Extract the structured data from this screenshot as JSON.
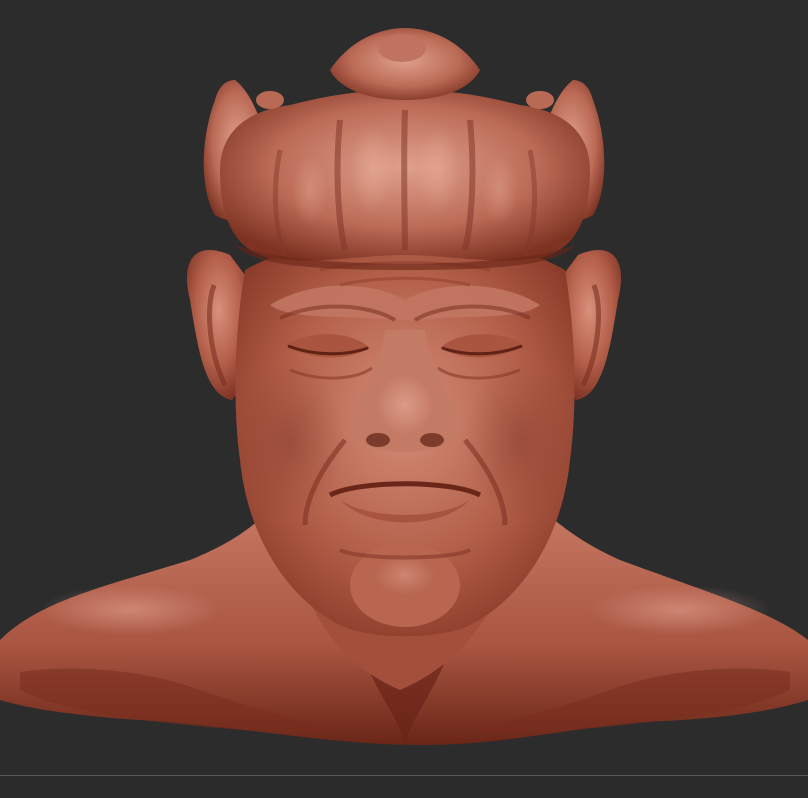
{
  "viewport": {
    "background": "#2c2c2c",
    "model": "sculpted-head-bust",
    "material_color": "#b5614d",
    "material_shadow": "#6e2a1c",
    "material_highlight": "#e0a18e"
  },
  "statusbar": {
    "divider_color": "#5a5a5a",
    "background": "#2a2a2a"
  }
}
